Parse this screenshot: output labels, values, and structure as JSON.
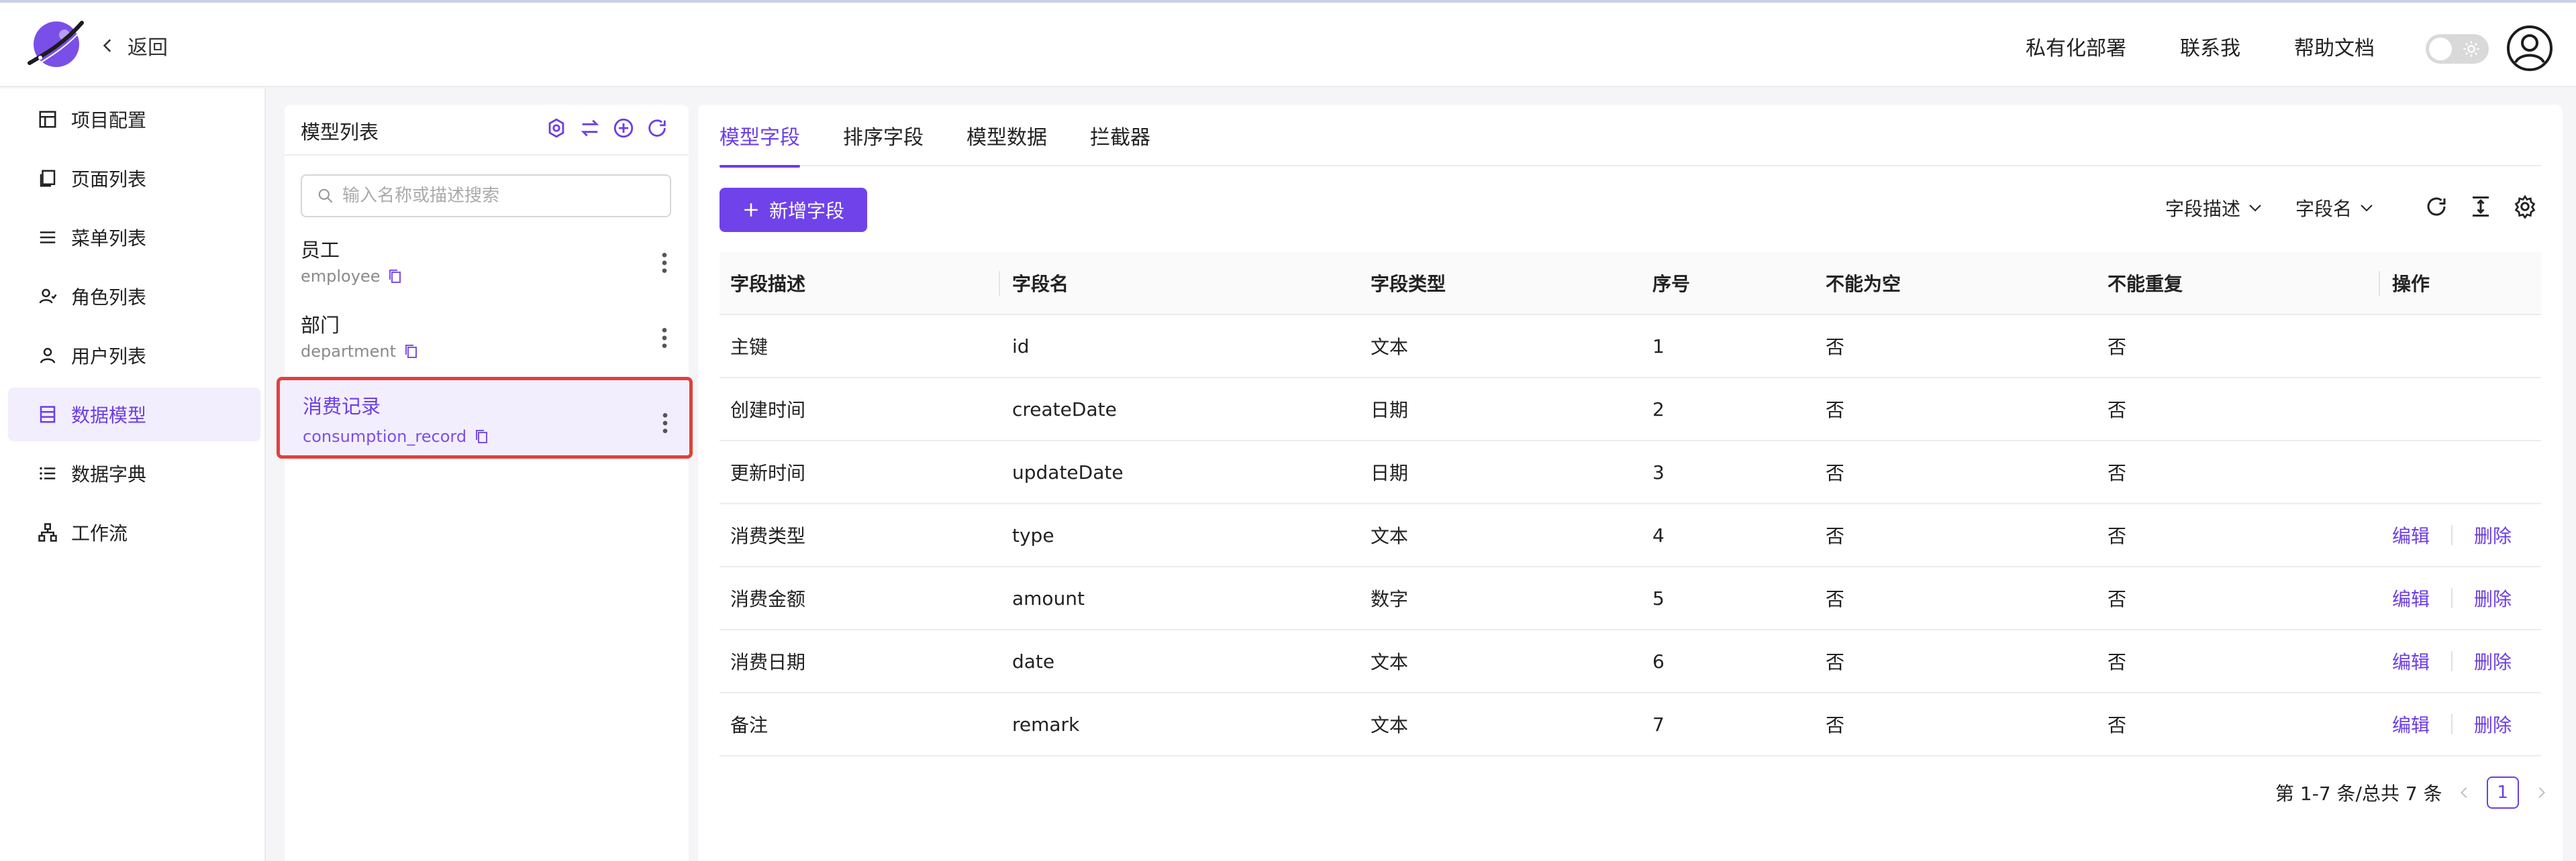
{
  "header": {
    "back_label": "返回",
    "nav": [
      "私有化部署",
      "联系我",
      "帮助文档"
    ]
  },
  "sidebar": {
    "items": [
      {
        "label": "项目配置",
        "icon": "layout-icon"
      },
      {
        "label": "页面列表",
        "icon": "pages-icon"
      },
      {
        "label": "菜单列表",
        "icon": "menu-icon"
      },
      {
        "label": "角色列表",
        "icon": "role-icon"
      },
      {
        "label": "用户列表",
        "icon": "user-icon"
      },
      {
        "label": "数据模型",
        "icon": "database-icon",
        "active": true
      },
      {
        "label": "数据字典",
        "icon": "list-icon"
      },
      {
        "label": "工作流",
        "icon": "workflow-icon"
      }
    ]
  },
  "model_panel": {
    "title": "模型列表",
    "search_placeholder": "输入名称或描述搜索",
    "models": [
      {
        "name": "员工",
        "code": "employee"
      },
      {
        "name": "部门",
        "code": "department"
      },
      {
        "name": "消费记录",
        "code": "consumption_record",
        "selected": true
      }
    ]
  },
  "main": {
    "tabs": [
      "模型字段",
      "排序字段",
      "模型数据",
      "拦截器"
    ],
    "active_tab": 0,
    "add_button": "新增字段",
    "filters": [
      "字段描述",
      "字段名"
    ],
    "columns": [
      "字段描述",
      "字段名",
      "字段类型",
      "序号",
      "不能为空",
      "不能重复",
      "操作"
    ],
    "rows": [
      {
        "desc": "主键",
        "name": "id",
        "type": "文本",
        "seq": "1",
        "not_null": "否",
        "unique": "否",
        "actions": false
      },
      {
        "desc": "创建时间",
        "name": "createDate",
        "type": "日期",
        "seq": "2",
        "not_null": "否",
        "unique": "否",
        "actions": false
      },
      {
        "desc": "更新时间",
        "name": "updateDate",
        "type": "日期",
        "seq": "3",
        "not_null": "否",
        "unique": "否",
        "actions": false
      },
      {
        "desc": "消费类型",
        "name": "type",
        "type": "文本",
        "seq": "4",
        "not_null": "否",
        "unique": "否",
        "actions": true
      },
      {
        "desc": "消费金额",
        "name": "amount",
        "type": "数字",
        "seq": "5",
        "not_null": "否",
        "unique": "否",
        "actions": true
      },
      {
        "desc": "消费日期",
        "name": "date",
        "type": "文本",
        "seq": "6",
        "not_null": "否",
        "unique": "否",
        "actions": true
      },
      {
        "desc": "备注",
        "name": "remark",
        "type": "文本",
        "seq": "7",
        "not_null": "否",
        "unique": "否",
        "actions": true
      }
    ],
    "edit_label": "编辑",
    "delete_label": "删除",
    "pagination": {
      "summary": "第 1-7 条/总共 7 条",
      "current": "1"
    }
  },
  "colors": {
    "accent": "#6c3ee6",
    "highlight_border": "#e0413b"
  }
}
